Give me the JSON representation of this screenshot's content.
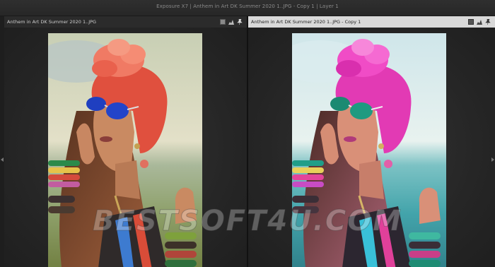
{
  "window": {
    "title": "Exposure X7 | Anthem in Art DK Summer 2020 1..JPG - Copy 1 | Layer 1"
  },
  "left_pane": {
    "title": "Anthem in Art DK Summer 2020 1..JPG",
    "image_name": "portrait-original"
  },
  "right_pane": {
    "title": "Anthem in Art DK Summer 2020 1..JPG - Copy 1",
    "image_name": "portrait-edited"
  },
  "header_icons": [
    "square-icon",
    "histogram-icon",
    "pin-icon"
  ],
  "watermark": "BESTSOFT4U.COM",
  "colors": {
    "background": "#232323",
    "active_header": "#d9d9d9",
    "inactive_header": "#2b2b2b"
  }
}
